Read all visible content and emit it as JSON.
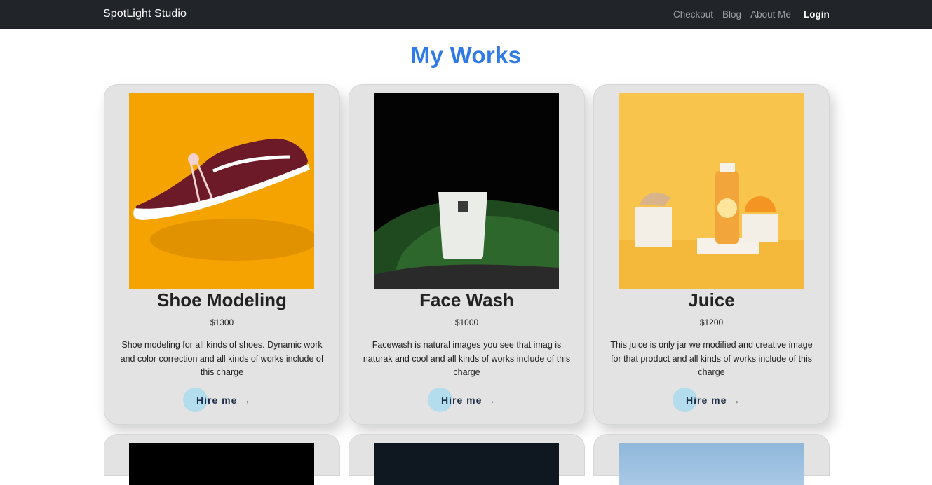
{
  "navbar": {
    "brand": "SpotLight Studio",
    "links": [
      "Checkout",
      "Blog",
      "About Me"
    ],
    "login": "Login"
  },
  "page": {
    "title": "My Works"
  },
  "cards": [
    {
      "title": "Shoe Modeling",
      "price": "$1300",
      "description": "Shoe modeling for all kinds of shoes. Dynamic work and color correction and all kinds of works include of this charge",
      "button": "Hire me →"
    },
    {
      "title": "Face Wash",
      "price": "$1000",
      "description": "Facewash is natural images you see that imag is naturak and cool and all kinds of works include of this charge",
      "button": "Hire me →"
    },
    {
      "title": "Juice",
      "price": "$1200",
      "description": "This juice is only jar we modified and creative image for that product and all kinds of works include of this charge",
      "button": "Hire me →"
    }
  ],
  "colors": {
    "navbar": "#212529",
    "title": "#2f7ae5",
    "card": "#e3e3e3",
    "hire_circle": "#b3dcec"
  }
}
